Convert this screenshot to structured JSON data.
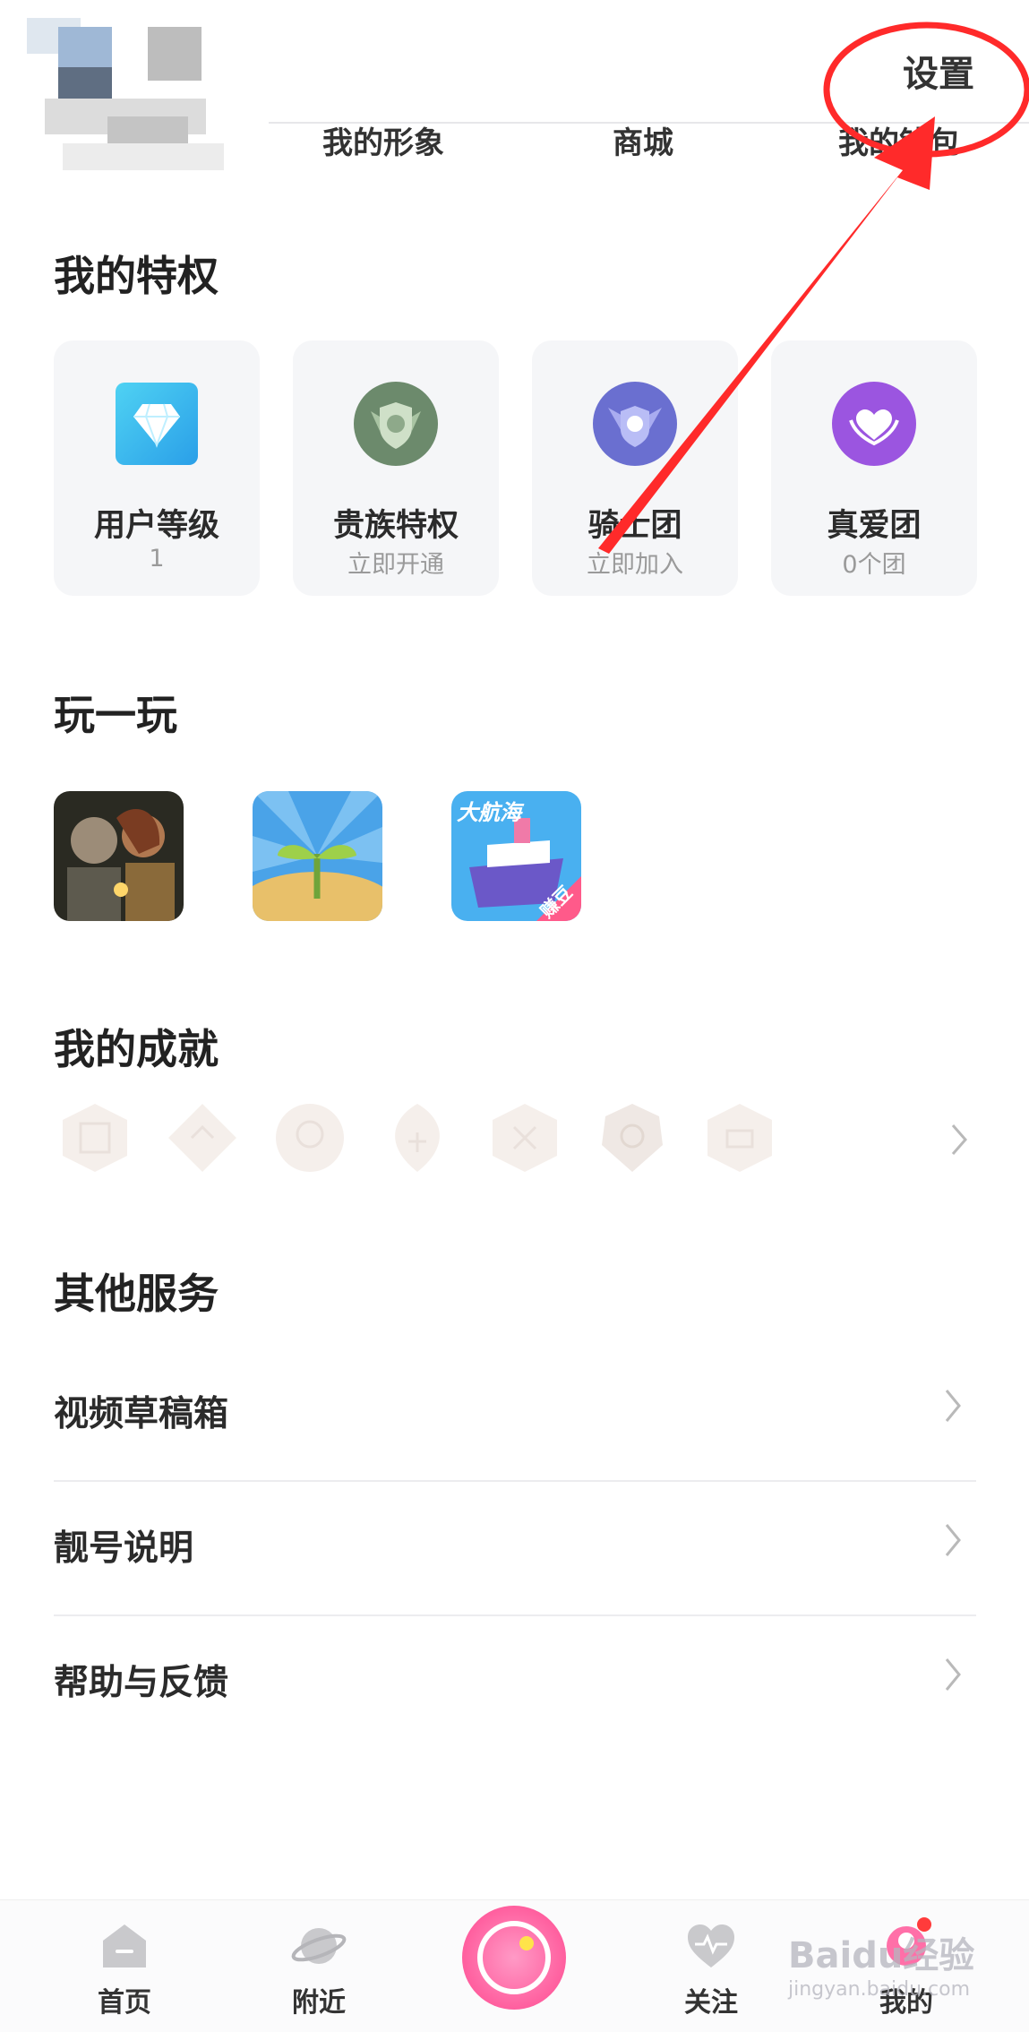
{
  "header": {
    "links": [
      "我的形象",
      "商城",
      "我的钱包"
    ],
    "settings_label": "设置"
  },
  "privileges": {
    "title": "我的特权",
    "items": [
      {
        "name": "用户等级",
        "sub": "1",
        "icon": "diamond-icon"
      },
      {
        "name": "贵族特权",
        "sub": "立即开通",
        "icon": "noble-shield-icon"
      },
      {
        "name": "骑士团",
        "sub": "立即加入",
        "icon": "knight-shield-icon"
      },
      {
        "name": "真爱团",
        "sub": "0个团",
        "icon": "heart-icon"
      }
    ]
  },
  "play": {
    "title": "玩一玩",
    "games": [
      {
        "icon": "game-warriors-icon"
      },
      {
        "icon": "game-sprout-icon"
      },
      {
        "icon": "game-voyage-icon",
        "caption": "大航海",
        "tag": "赚豆"
      }
    ]
  },
  "achievements": {
    "title": "我的成就",
    "badges": [
      "badge-1-icon",
      "badge-2-icon",
      "badge-3-icon",
      "badge-4-icon",
      "badge-5-icon",
      "badge-6-icon",
      "badge-7-icon"
    ]
  },
  "services": {
    "title": "其他服务",
    "items": [
      "视频草稿箱",
      "靓号说明",
      "帮助与反馈"
    ]
  },
  "tabbar": {
    "tabs": [
      {
        "label": "首页",
        "icon": "home-icon"
      },
      {
        "label": "附近",
        "icon": "planet-icon"
      },
      {
        "label": "",
        "icon": "live-record-icon"
      },
      {
        "label": "关注",
        "icon": "heart-pulse-icon"
      },
      {
        "label": "我的",
        "icon": "profile-icon"
      }
    ]
  },
  "watermark": {
    "brand": "Baidu经验",
    "url": "jingyan.baidu.com"
  },
  "colors": {
    "annotation": "#ff2a2a",
    "accent_pink": "#ff6fa8"
  }
}
